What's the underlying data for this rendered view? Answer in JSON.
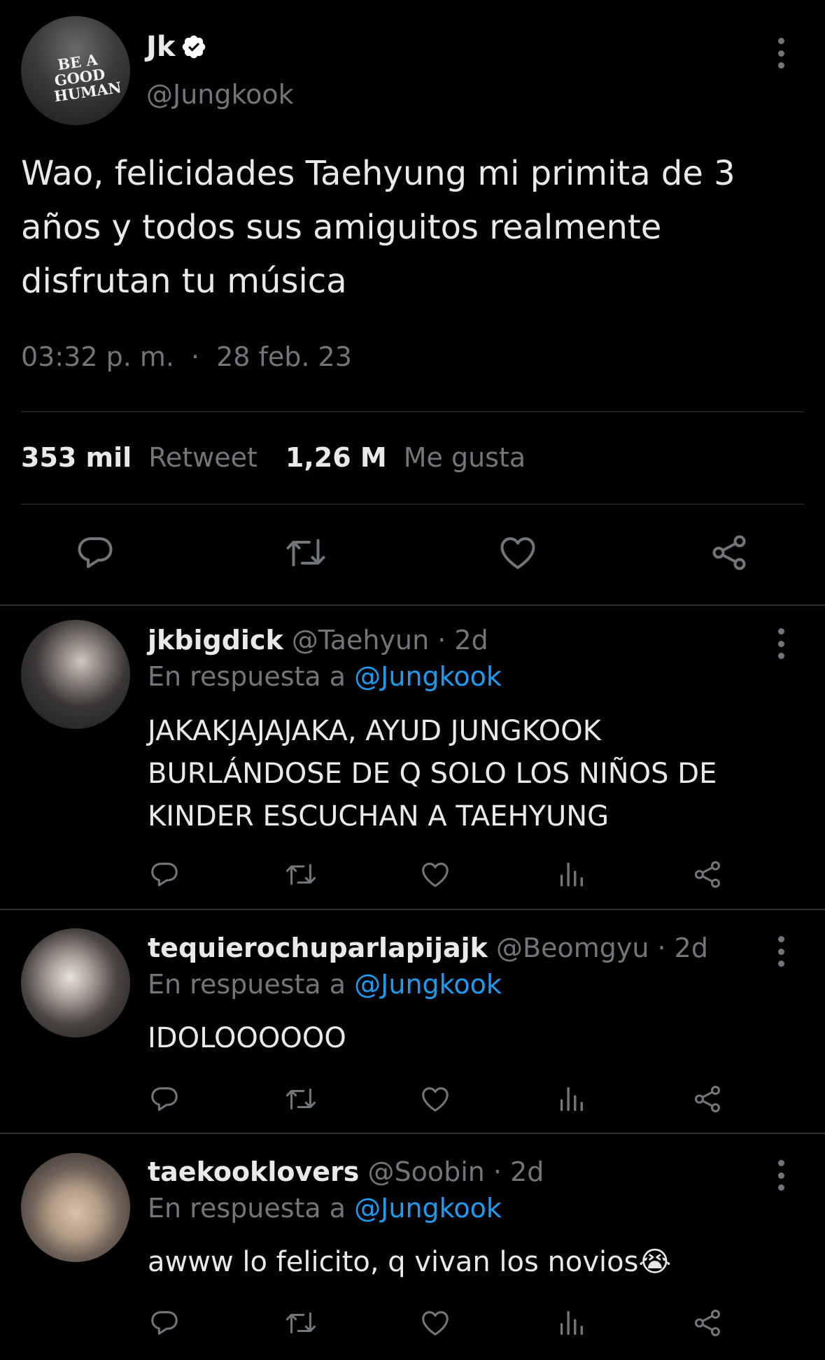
{
  "tweet": {
    "avatar_text": "BE A\nGOOD\nHUMAN",
    "name": "Jk",
    "handle": "@Jungkook",
    "text": "Wao, felicidades Taehyung mi primita de 3\naños y todos sus amiguitos realmente\ndisfrutan tu música",
    "time": "03:32 p. m.",
    "separator": "·",
    "date": "28 feb. 23",
    "retweets_count": "353 mil",
    "retweets_label": "Retweet",
    "likes_count": "1,26 M",
    "likes_label": "Me gusta",
    "icons": [
      "reply-icon",
      "retweet-icon",
      "like-icon",
      "share-icon"
    ]
  },
  "replies": [
    {
      "name": "jkbigdick",
      "handle": "@Taehyun · 2d",
      "reply_prefix": "En respuesta a",
      "reply_to": "@Jungkook",
      "text": "JAKAKJAJAJAKA, AYUD JUNGKOOK\nBURLÁNDOSE DE Q SOLO LOS NIÑOS DE\nKINDER ESCUCHAN A TAEHYUNG"
    },
    {
      "name": "tequierochuparlapijajk",
      "handle": "@Beomgyu · 2d",
      "reply_prefix": "En respuesta a",
      "reply_to": "@Jungkook",
      "text": "IDOLOOOOOO"
    },
    {
      "name": "taekooklovers",
      "handle": "@Soobin · 2d",
      "reply_prefix": "En respuesta a",
      "reply_to": "@Jungkook",
      "text": "awww lo felicito, q vivan los novios😭"
    }
  ],
  "colors": {
    "background": "#000000",
    "text": "#e7e9ea",
    "muted": "#71767b",
    "link": "#1d9bf0",
    "divider": "#2f3336"
  }
}
